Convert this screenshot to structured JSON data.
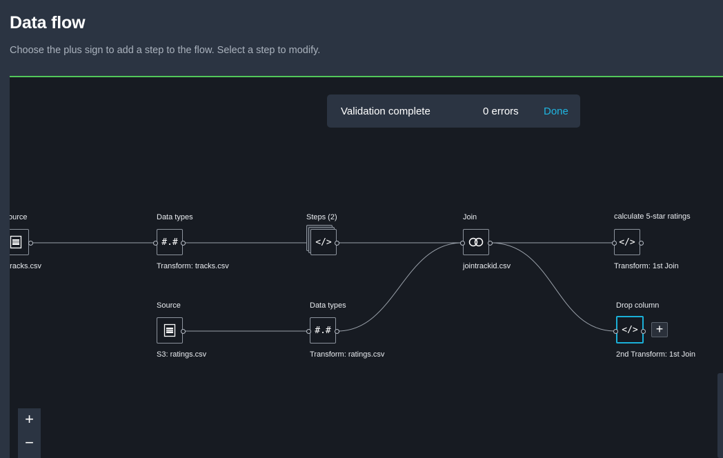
{
  "header": {
    "title": "Data flow",
    "subtitle": "Choose the plus sign to add a step to the flow. Select a step to modify."
  },
  "validation": {
    "status": "Validation complete",
    "errors": "0 errors",
    "done_label": "Done"
  },
  "nodes": {
    "source_tracks": {
      "top_label": "ource",
      "bottom_label": ": tracks.csv",
      "icon": "file-table-icon"
    },
    "datatypes_tracks": {
      "top_label": "Data types",
      "bottom_label": "Transform: tracks.csv",
      "glyph": "#.#"
    },
    "steps": {
      "top_label": "Steps (2)",
      "glyph": "</>"
    },
    "join": {
      "top_label": "Join",
      "bottom_label": "jointrackid.csv",
      "icon": "join-circles-icon"
    },
    "calc_5star": {
      "top_label": "calculate 5-star ratings",
      "bottom_label": "Transform: 1st Join",
      "glyph": "</>"
    },
    "source_ratings": {
      "top_label": "Source",
      "bottom_label": "S3: ratings.csv",
      "icon": "file-table-icon"
    },
    "datatypes_ratings": {
      "top_label": "Data types",
      "bottom_label": "Transform: ratings.csv",
      "glyph": "#.#"
    },
    "drop_column": {
      "top_label": "Drop column",
      "bottom_label": "2nd Transform: 1st Join",
      "glyph": "</>"
    }
  },
  "add_step": {
    "label": "+"
  },
  "zoom": {
    "in_label": "+",
    "out_label": "−"
  },
  "colors": {
    "accent_green": "#52c85a",
    "selection_blue": "#1ab0d8",
    "link_blue": "#1fb5e0"
  }
}
